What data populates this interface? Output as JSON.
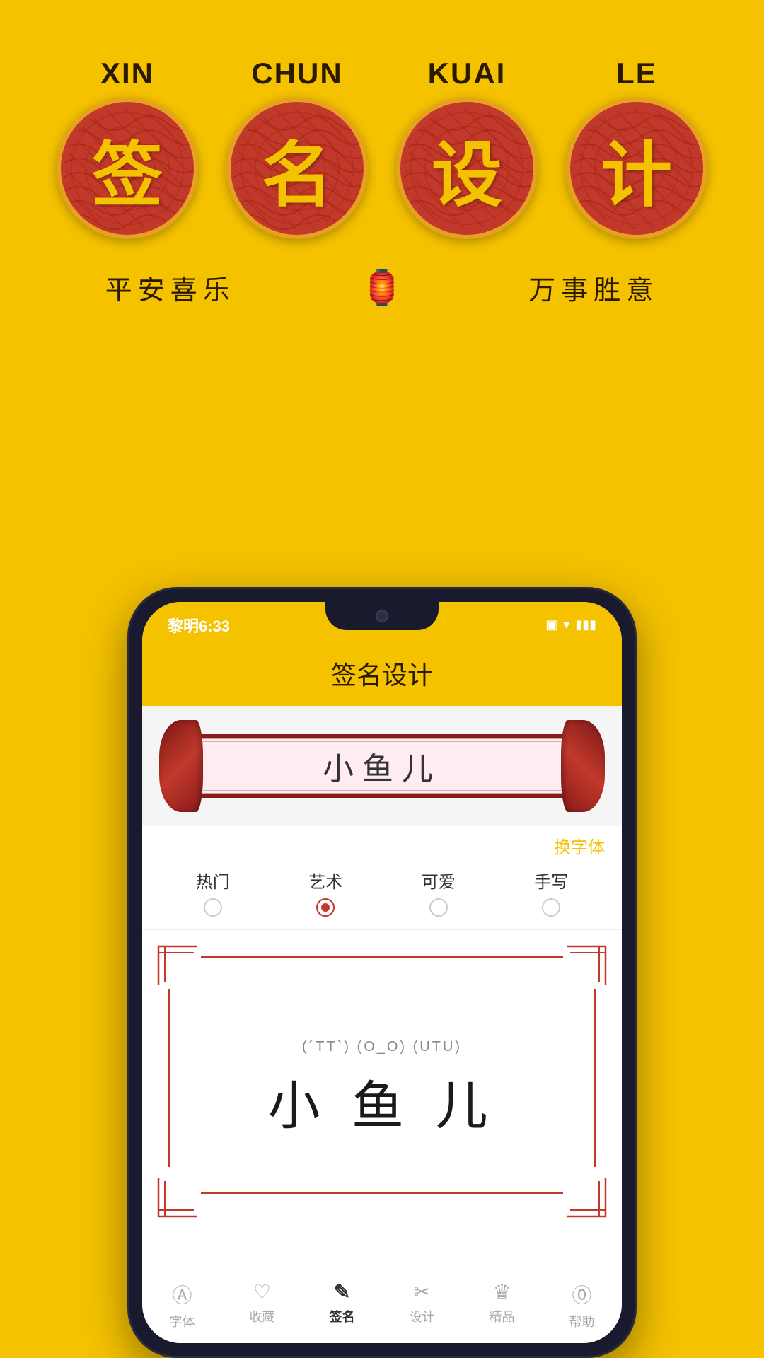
{
  "background_color": "#F5C200",
  "header": {
    "characters": [
      {
        "pinyin": "XIN",
        "char": "签"
      },
      {
        "pinyin": "CHUN",
        "char": "名"
      },
      {
        "pinyin": "KUAI",
        "char": "设"
      },
      {
        "pinyin": "LE",
        "char": "计"
      }
    ],
    "subtitle_left": "平安喜乐",
    "subtitle_right": "万事胜意"
  },
  "phone": {
    "status_bar": {
      "time": "黎明6:33",
      "icons": "▣ ▾ ▮▮▮"
    },
    "app_title": "签名设计",
    "scroll_name": "小鱼儿",
    "change_font_label": "换字体",
    "font_tabs": [
      {
        "label": "热门",
        "active": false
      },
      {
        "label": "艺术",
        "active": true
      },
      {
        "label": "可爱",
        "active": false
      },
      {
        "label": "手写",
        "active": false
      }
    ],
    "preview_emotion": "(´TT`) (O_O) (UTU)",
    "preview_name": "小 鱼 儿",
    "nav_items": [
      {
        "label": "字体",
        "icon": "Ⓐ",
        "active": false
      },
      {
        "label": "收藏",
        "icon": "♡",
        "active": false
      },
      {
        "label": "签名",
        "icon": "✎",
        "active": true
      },
      {
        "label": "设计",
        "icon": "✂",
        "active": false
      },
      {
        "label": "精品",
        "icon": "♛",
        "active": false
      },
      {
        "label": "帮助",
        "icon": "?",
        "active": false
      }
    ]
  }
}
